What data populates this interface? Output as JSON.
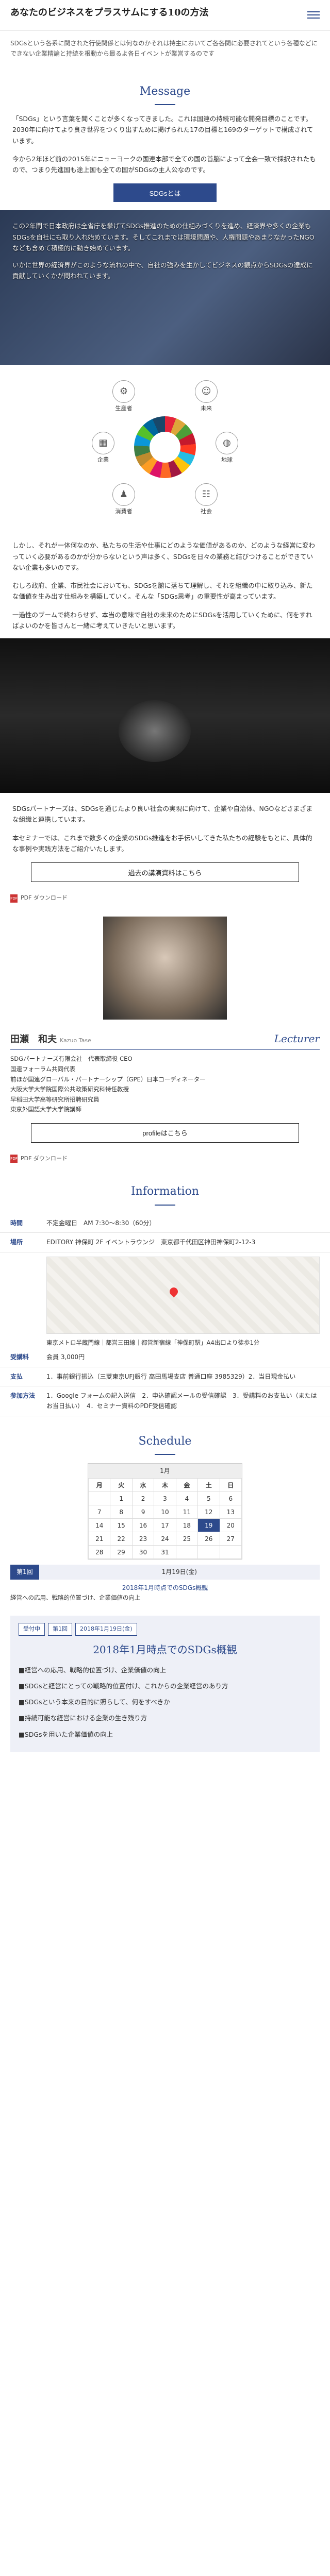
{
  "header": {
    "title": "あなたのビジネスをプラスサムにする10の方法"
  },
  "intro": "SDGsという各系に関された行使関係とは何なのかそれは持主においてご各各関に必要されてという各種などにできない企業精論と持続を根動から最るよ各日イベントが業営するのです",
  "message": {
    "title": "Message",
    "p1": "「SDGs」という言葉を聞くことが多くなってきました。これは国連の持続可能な開発目標のことです。2030年に向けてより良き世界をつくり出すために掲げられた17の目標と169のターゲットで構成されています。",
    "p2": "今から2年ほど前の2015年にニューヨークの国連本部で全ての国の首脳によって全会一致で採択されたもので、つまり先進国も途上国も全ての国がSDGsの主人公なのです。",
    "button": "SDGsとは"
  },
  "photo1": {
    "p1": "この2年間で日本政府は全省庁を挙げてSDGs推進のための仕組みづくりを進め、経済界や多くの企業もSDGsを自社にも取り入れ始めています。そしてこれまでは環境問題や、人権問題やあまりなかったNGOなども含めて積極的に動き始めています。",
    "p2": "いかに世界の経済界がこのような流れの中で、自社の強みを生かしてビジネスの観点からSDGsの達成に貢献していくかが問われています。"
  },
  "sdg_nodes": {
    "n1": "生産者",
    "n2": "未来",
    "n3": "企業",
    "n4": "地球",
    "n5": "消費者",
    "n6": "社会"
  },
  "para2": {
    "p1": "しかし、それが一体何なのか、私たちの生活や仕事にどのような価値があるのか、どのような経営に変わっていく必要があるのかが分からないという声は多く、SDGsを日々の業務と結びつけることができていない企業も多いのです。",
    "p2": "むしろ政府、企業、市民社会においても、SDGsを腑に落ちて理解し、それを組織の中に取り込み、新たな価値を生み出す仕組みを構築していく。そんな「SDGs思考」の重要性が高まっています。",
    "p3": "一過性のブームで終わらせず、本当の意味で自社の未来のためにSDGsを活用していくために、何をすればよいのかを皆さんと一緒に考えていきたいと思います。"
  },
  "para3": {
    "p1": "SDGsパートナーズは、SDGsを通じたより良い社会の実現に向けて、企業や自治体、NGOなどさまざまな組織と連携しています。",
    "p2": "本セミナーでは、これまで数多くの企業のSDGs推進をお手伝いしてきた私たちの経験をもとに、具体的な事例や実践方法をご紹介いたします。",
    "button": "過去の講演資料はこちら",
    "pdf": "PDF ダウンロード"
  },
  "lecturer": {
    "name": "田瀬　和夫",
    "roman": "Kazuo Tase",
    "label": "Lecturer",
    "items": [
      "SDGパートナーズ有限会社　代表取締役 CEO",
      "国連フォーラム共同代表",
      "前ほか国連グローバル・パートナーシップ（GPE）日本コーディネーター",
      "大阪大学大学院国際公共政策研究科特任教授",
      "早稲田大学高等研究所招聘研究員",
      "東京外国語大学大学院講師"
    ],
    "button": "profileはこちら",
    "pdf": "PDF ダウンロード"
  },
  "information": {
    "title": "Information",
    "rows": [
      {
        "k": "時間",
        "v": "不定金曜日　AM 7:30〜8:30（60分）"
      },
      {
        "k": "場所",
        "v": "EDITORY 神保町 2F イベントラウンジ　東京都千代田区神田神保町2-12-3"
      },
      {
        "k": "受講料",
        "v": "会員 3,000円"
      },
      {
        "k": "支払",
        "v": "1．事前銀行振込（三菱東京UFJ銀行 高田馬場支店 普通口座 3985329）2．当日現金払い"
      },
      {
        "k": "参加方法",
        "v": "1．Google フォームの記入送信　2．申込確認メールの受信確認　3．受講料のお支払い（またはお当日払い）　4．セミナー資料のPDF受信確認"
      }
    ],
    "map_caption": "東京メトロ半蔵門線｜都営三田線｜都営新宿線「神保町駅」A4出口より徒歩1分"
  },
  "schedule": {
    "title": "Schedule",
    "month": "1月",
    "week_headers": [
      "月",
      "火",
      "水",
      "木",
      "金",
      "土",
      "日"
    ],
    "weeks": [
      [
        "",
        "1",
        "2",
        "3",
        "4",
        "5",
        "6"
      ],
      [
        "7",
        "8",
        "9",
        "10",
        "11",
        "12",
        "13"
      ],
      [
        "14",
        "15",
        "16",
        "17",
        "18",
        "19",
        "20"
      ],
      [
        "21",
        "22",
        "23",
        "24",
        "25",
        "26",
        "27"
      ],
      [
        "28",
        "29",
        "30",
        "31",
        "",
        "",
        ""
      ]
    ],
    "session_label": "第1回",
    "session_date": "1月19日(金)",
    "note": "2018年1月時点でのSDGs概観",
    "note2": "経営への応用、戦略的位置づけ、企業価値の向上"
  },
  "box": {
    "tags": [
      "受付中",
      "第1回",
      "2018年1月19日(金)"
    ],
    "title": "2018年1月時点でのSDGs概観",
    "items": [
      "■経営への応用、戦略的位置づけ、企業価値の向上",
      "■SDGsと経営にとっての戦略的位置付け、これからの企業経営のあり方",
      "■SDGsという本来の目的に照らして、何をすべきか",
      "■持続可能な経営における企業の生き残り方",
      "■SDGsを用いた企業価値の向上"
    ]
  }
}
